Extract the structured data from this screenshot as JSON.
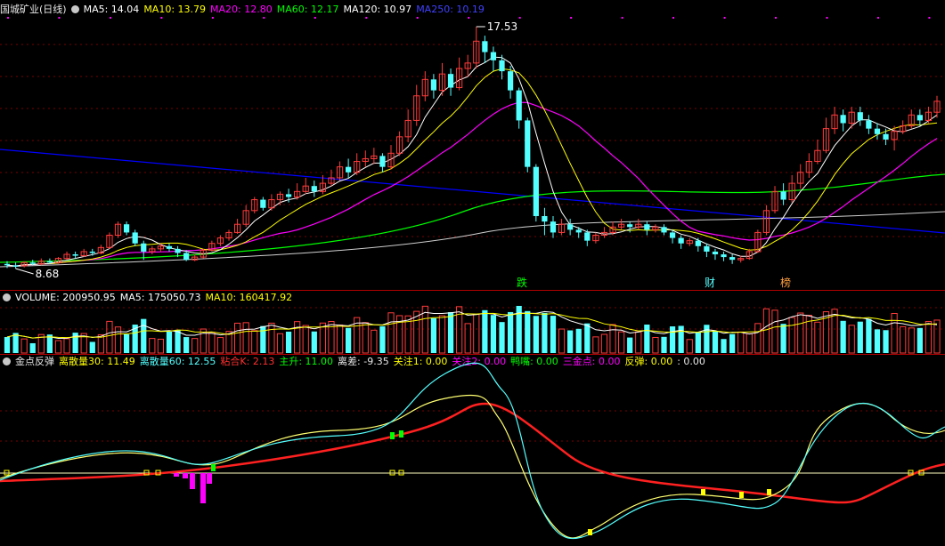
{
  "price_header": {
    "stock_title": "国城矿业(日线)",
    "ma5": "MA5: 14.04",
    "ma10": "MA10: 13.79",
    "ma20": "MA20: 12.80",
    "ma60": "MA60: 12.17",
    "ma120": "MA120: 10.97",
    "ma250": "MA250: 10.19"
  },
  "volume_header": {
    "volume": "VOLUME: 200950.95",
    "ma5": "MA5: 175050.73",
    "ma10": "MA10: 160417.92"
  },
  "indicator_header": {
    "name": "金点反弹",
    "lisan30": "离散量30: 11.49",
    "lisan60": "离散量60: 12.55",
    "nianhe": "粘合K: 2.13",
    "zhusheng": "主升: 11.00",
    "licha": "离差: -9.35",
    "guanzhu1": "关注1: 0.00",
    "guanzhu2": "关注2: 0.00",
    "yazui": "鸭嘴: 0.00",
    "sanjindian": "三金点: 0.00",
    "fantan": "反弹: 0.00",
    "extra": ": 0.00"
  },
  "price_annotations": {
    "high": "17.53",
    "low": "8.68",
    "marker_1": "跌",
    "marker_2": "财",
    "marker_3": "榜"
  },
  "colors": {
    "up": "#ff3c3c",
    "down": "#54ffff",
    "ma5": "#ffffff",
    "ma10": "#ffff00",
    "ma20": "#ff00ff",
    "ma60": "#00ff00",
    "ma120": "#ffffff",
    "ma250": "#0000ff",
    "separator": "#b00000"
  },
  "chart_data": {
    "type": "candlestick",
    "ylim": [
      8.68,
      17.53
    ],
    "candles": [
      [
        8.85,
        8.8,
        8.95,
        8.7
      ],
      [
        8.8,
        8.75,
        8.9,
        8.68
      ],
      [
        8.78,
        8.9,
        8.95,
        8.72
      ],
      [
        8.9,
        8.85,
        9.0,
        8.8
      ],
      [
        8.85,
        8.95,
        9.05,
        8.8
      ],
      [
        8.95,
        8.9,
        9.05,
        8.85
      ],
      [
        8.9,
        9.05,
        9.1,
        8.85
      ],
      [
        9.05,
        9.2,
        9.3,
        9.0
      ],
      [
        9.2,
        9.15,
        9.3,
        9.05
      ],
      [
        9.15,
        9.3,
        9.4,
        9.1
      ],
      [
        9.3,
        9.25,
        9.4,
        9.15
      ],
      [
        9.25,
        9.45,
        9.55,
        9.2
      ],
      [
        9.45,
        9.9,
        10.0,
        9.4
      ],
      [
        9.9,
        10.3,
        10.4,
        9.8
      ],
      [
        10.3,
        10.0,
        10.4,
        9.9
      ],
      [
        10.0,
        9.6,
        10.1,
        9.5
      ],
      [
        9.6,
        9.3,
        9.7,
        9.0
      ],
      [
        9.3,
        9.4,
        9.5,
        9.2
      ],
      [
        9.4,
        9.5,
        9.6,
        9.3
      ],
      [
        9.5,
        9.4,
        9.6,
        9.3
      ],
      [
        9.4,
        9.25,
        9.5,
        9.1
      ],
      [
        9.25,
        9.0,
        9.35,
        8.95
      ],
      [
        9.0,
        9.1,
        9.2,
        8.95
      ],
      [
        9.1,
        9.35,
        9.4,
        9.05
      ],
      [
        9.35,
        9.6,
        9.7,
        9.3
      ],
      [
        9.6,
        9.8,
        9.9,
        9.5
      ],
      [
        9.8,
        10.0,
        10.1,
        9.7
      ],
      [
        10.0,
        10.3,
        10.5,
        9.95
      ],
      [
        10.3,
        10.8,
        11.0,
        10.2
      ],
      [
        10.8,
        11.2,
        11.3,
        10.7
      ],
      [
        11.2,
        10.9,
        11.3,
        10.8
      ],
      [
        10.9,
        11.2,
        11.4,
        10.8
      ],
      [
        11.2,
        11.4,
        11.5,
        11.0
      ],
      [
        11.4,
        11.3,
        11.6,
        11.1
      ],
      [
        11.3,
        11.5,
        11.8,
        11.2
      ],
      [
        11.5,
        11.7,
        12.0,
        11.4
      ],
      [
        11.7,
        11.5,
        11.9,
        11.3
      ],
      [
        11.5,
        11.8,
        12.1,
        11.4
      ],
      [
        11.8,
        12.0,
        12.3,
        11.7
      ],
      [
        12.0,
        12.4,
        12.6,
        11.9
      ],
      [
        12.4,
        12.2,
        12.7,
        12.0
      ],
      [
        12.2,
        12.6,
        12.9,
        12.1
      ],
      [
        12.6,
        12.7,
        13.0,
        12.4
      ],
      [
        12.7,
        12.8,
        13.1,
        12.5
      ],
      [
        12.8,
        12.4,
        12.9,
        12.2
      ],
      [
        12.4,
        12.9,
        13.2,
        12.3
      ],
      [
        12.9,
        13.5,
        13.7,
        12.8
      ],
      [
        13.5,
        14.1,
        14.5,
        13.3
      ],
      [
        14.1,
        15.0,
        15.4,
        13.9
      ],
      [
        15.0,
        15.6,
        15.9,
        14.8
      ],
      [
        15.6,
        15.2,
        15.8,
        14.9
      ],
      [
        15.2,
        15.8,
        16.2,
        15.0
      ],
      [
        15.8,
        15.3,
        16.0,
        15.0
      ],
      [
        15.3,
        16.0,
        16.4,
        15.2
      ],
      [
        16.0,
        16.2,
        16.5,
        15.7
      ],
      [
        16.2,
        17.0,
        17.53,
        16.0
      ],
      [
        17.0,
        16.6,
        17.2,
        16.2
      ],
      [
        16.6,
        16.3,
        16.8,
        15.9
      ],
      [
        16.3,
        15.9,
        16.5,
        15.6
      ],
      [
        15.9,
        15.2,
        16.1,
        14.9
      ],
      [
        15.2,
        14.1,
        15.3,
        13.8
      ],
      [
        14.1,
        12.4,
        14.2,
        12.2
      ],
      [
        12.4,
        10.6,
        12.5,
        10.4
      ],
      [
        10.6,
        10.4,
        10.9,
        9.9
      ],
      [
        10.4,
        10.0,
        10.6,
        9.8
      ],
      [
        10.0,
        10.3,
        10.5,
        9.9
      ],
      [
        10.3,
        10.1,
        10.5,
        9.9
      ],
      [
        10.1,
        10.0,
        10.2,
        9.8
      ],
      [
        10.0,
        9.7,
        10.1,
        9.5
      ],
      [
        9.7,
        9.9,
        10.0,
        9.6
      ],
      [
        9.9,
        10.0,
        10.2,
        9.8
      ],
      [
        10.0,
        10.2,
        10.4,
        9.9
      ],
      [
        10.2,
        10.3,
        10.5,
        10.1
      ],
      [
        10.3,
        10.2,
        10.4,
        10.0
      ],
      [
        10.2,
        10.3,
        10.5,
        10.1
      ],
      [
        10.3,
        10.1,
        10.4,
        9.9
      ],
      [
        10.1,
        10.2,
        10.3,
        10.0
      ],
      [
        10.2,
        10.0,
        10.3,
        9.9
      ],
      [
        10.0,
        9.8,
        10.1,
        9.6
      ],
      [
        9.8,
        9.6,
        9.9,
        9.4
      ],
      [
        9.6,
        9.7,
        9.8,
        9.5
      ],
      [
        9.7,
        9.5,
        9.8,
        9.3
      ],
      [
        9.5,
        9.3,
        9.6,
        9.1
      ],
      [
        9.3,
        9.2,
        9.4,
        9.0
      ],
      [
        9.2,
        9.1,
        9.3,
        8.95
      ],
      [
        9.1,
        9.0,
        9.2,
        8.85
      ],
      [
        9.0,
        9.05,
        9.15,
        8.9
      ],
      [
        9.05,
        9.3,
        9.4,
        9.0
      ],
      [
        9.3,
        10.0,
        10.1,
        9.25
      ],
      [
        10.0,
        10.8,
        11.0,
        9.9
      ],
      [
        10.8,
        11.5,
        11.7,
        10.7
      ],
      [
        11.5,
        11.2,
        11.8,
        11.0
      ],
      [
        11.2,
        11.8,
        12.1,
        11.1
      ],
      [
        11.8,
        12.2,
        12.5,
        11.6
      ],
      [
        12.2,
        12.6,
        12.9,
        12.0
      ],
      [
        12.6,
        13.0,
        13.4,
        12.5
      ],
      [
        13.0,
        13.8,
        14.2,
        12.9
      ],
      [
        13.8,
        14.3,
        14.6,
        13.6
      ],
      [
        14.3,
        14.0,
        14.5,
        13.7
      ],
      [
        14.0,
        14.4,
        14.6,
        13.8
      ],
      [
        14.4,
        14.1,
        14.6,
        13.9
      ],
      [
        14.1,
        13.8,
        14.3,
        13.6
      ],
      [
        13.8,
        13.6,
        14.0,
        13.4
      ],
      [
        13.6,
        13.4,
        13.8,
        13.2
      ],
      [
        13.4,
        13.7,
        13.9,
        13.0
      ],
      [
        13.7,
        13.9,
        14.1,
        13.6
      ],
      [
        13.9,
        14.3,
        14.5,
        13.8
      ],
      [
        14.3,
        14.1,
        14.5,
        13.9
      ],
      [
        14.1,
        14.4,
        14.6,
        14.0
      ],
      [
        14.4,
        14.8,
        15.0,
        14.2
      ]
    ]
  }
}
